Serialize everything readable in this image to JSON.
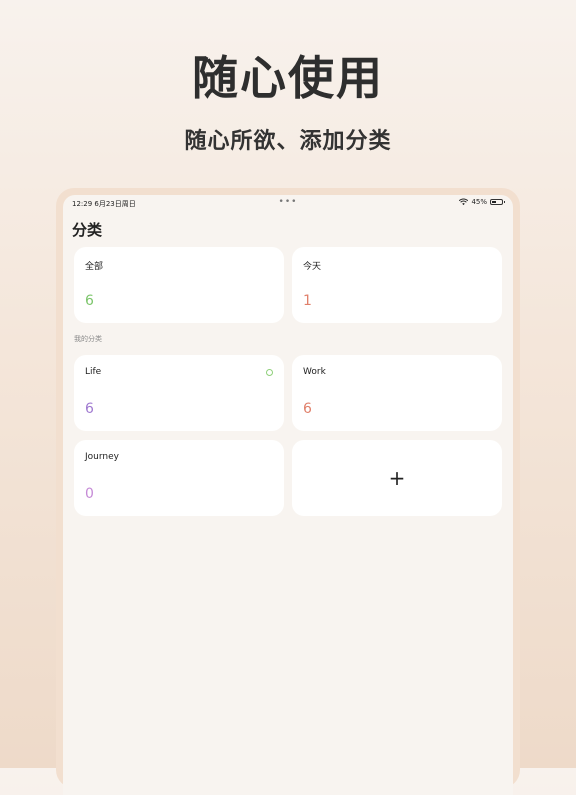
{
  "hero": {
    "title": "随心使用",
    "subtitle": "随心所欲、添加分类"
  },
  "status_bar": {
    "time": "12:29   6月23日周日",
    "dots": "•••",
    "battery": "45%"
  },
  "page": {
    "title": "分类",
    "section_label": "我的分类"
  },
  "summary_cards": [
    {
      "label": "全部",
      "count": "6",
      "color": "#7cc56b"
    },
    {
      "label": "今天",
      "count": "1",
      "color": "#e0806b"
    }
  ],
  "categories": [
    {
      "label": "Life",
      "count": "6",
      "color": "#a07ad0",
      "dot_color": "#8fd07a"
    },
    {
      "label": "Work",
      "count": "6",
      "color": "#e0806b"
    },
    {
      "label": "Journey",
      "count": "0",
      "color": "#c58ad6"
    }
  ],
  "add_card": {
    "icon": "plus-icon",
    "glyph": "+"
  }
}
